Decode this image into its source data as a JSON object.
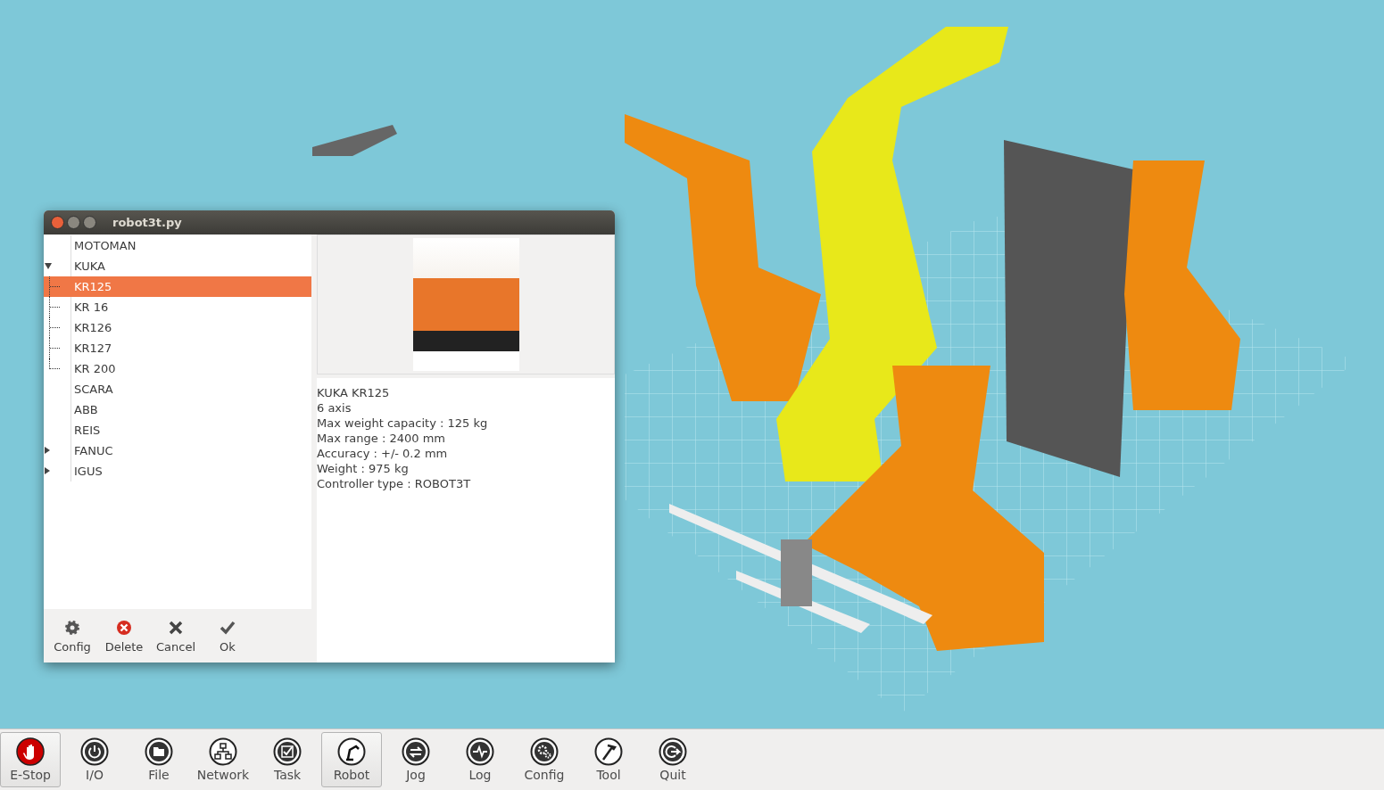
{
  "window": {
    "title": "robot3t.py"
  },
  "tree": {
    "items": [
      {
        "label": "MOTOMAN",
        "expanded": false,
        "selected": false
      },
      {
        "label": "KUKA",
        "expanded": true,
        "selected": false,
        "children": [
          {
            "label": "KR125",
            "selected": true
          },
          {
            "label": "KR 16",
            "selected": false
          },
          {
            "label": "KR126",
            "selected": false
          },
          {
            "label": "KR127",
            "selected": false
          },
          {
            "label": "KR 200",
            "selected": false
          }
        ]
      },
      {
        "label": "SCARA",
        "expanded": false,
        "selected": false
      },
      {
        "label": "ABB",
        "expanded": false,
        "selected": false
      },
      {
        "label": "REIS",
        "expanded": false,
        "selected": false
      },
      {
        "label": "FANUC",
        "expanded": false,
        "collapsed_arrow": true,
        "selected": false
      },
      {
        "label": "IGUS",
        "expanded": false,
        "collapsed_arrow": true,
        "selected": false
      }
    ]
  },
  "dialog_buttons": [
    {
      "label": "Config",
      "kind": "gear"
    },
    {
      "label": "Delete",
      "kind": "delete"
    },
    {
      "label": "Cancel",
      "kind": "cross"
    },
    {
      "label": "Ok",
      "kind": "check"
    }
  ],
  "details": [
    "KUKA KR125",
    "6 axis",
    "Max weight capacity : 125 kg",
    "Max range : 2400 mm",
    "Accuracy : +/- 0.2 mm",
    "Weight : 975 kg",
    "Controller type : ROBOT3T"
  ],
  "toolbar": [
    {
      "label": "E-Stop",
      "kind": "estop",
      "pressed": true
    },
    {
      "label": "I/O",
      "kind": "power",
      "pressed": false
    },
    {
      "label": "File",
      "kind": "folder",
      "pressed": false
    },
    {
      "label": "Network",
      "kind": "network",
      "pressed": false
    },
    {
      "label": "Task",
      "kind": "task",
      "pressed": false
    },
    {
      "label": "Robot",
      "kind": "robot",
      "pressed": true
    },
    {
      "label": "Jog",
      "kind": "jog",
      "pressed": false
    },
    {
      "label": "Log",
      "kind": "log",
      "pressed": false
    },
    {
      "label": "Config",
      "kind": "gears",
      "pressed": false
    },
    {
      "label": "Tool",
      "kind": "tool",
      "pressed": false
    },
    {
      "label": "Quit",
      "kind": "quit",
      "pressed": false
    }
  ]
}
